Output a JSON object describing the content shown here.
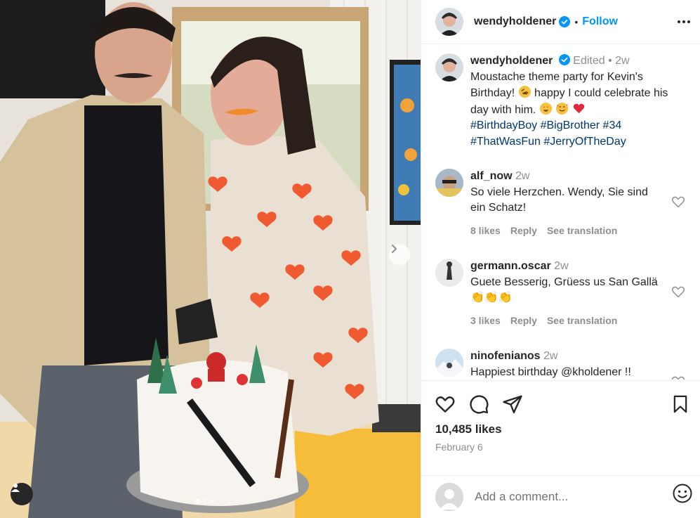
{
  "post": {
    "username": "wendyholdener",
    "follow_label": "Follow",
    "separator": "•",
    "caption": {
      "edited": "Edited",
      "bullet": "•",
      "age": "2w",
      "text_line1": "Moustache theme party for Kevin's",
      "text_line2a": "Birthday!",
      "text_line2b": "happy I could celebrate his",
      "text_line3": "day with him.",
      "hashtags_line1": "#BirthdayBoy #BigBrother #34",
      "hashtags_line2": "#ThatWasFun #JerryOfTheDay"
    },
    "likes": "10,485 likes",
    "date": "February 6"
  },
  "comments": [
    {
      "user": "alf_now",
      "age": "2w",
      "text_line1": "So viele Herzchen. Wendy, Sie sind",
      "text_line2": "ein Schatz!",
      "likes": "8 likes",
      "reply": "Reply",
      "translate": "See translation"
    },
    {
      "user": "germann.oscar",
      "age": "2w",
      "text_line1": "Guete Besserig, Grüess us San Gallä",
      "emojis": "👏👏👏",
      "likes": "3 likes",
      "reply": "Reply",
      "translate": "See translation"
    },
    {
      "user": "ninofenianos",
      "age": "2w",
      "text_line1": "Happiest birthday @kholdener !!"
    }
  ],
  "add_comment": {
    "placeholder": "Add a comment..."
  },
  "colors": {
    "accent": "#0095f6",
    "verified": "#0095f6",
    "hashtag": "#00376b",
    "muted": "#8e8e8e"
  }
}
